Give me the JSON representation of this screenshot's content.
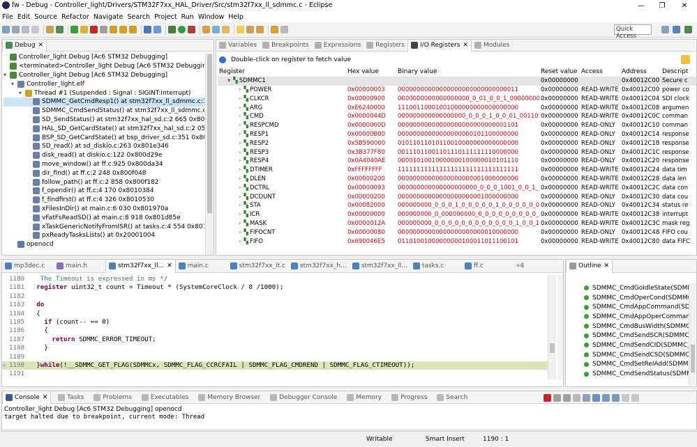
{
  "window": {
    "title": "fw - Debug - Controller_light/Drivers/STM32F7xx_HAL_Driver/Src/stm32f7xx_ll_sdmmc.c - Eclipse"
  },
  "menu": [
    "File",
    "Edit",
    "Source",
    "Refactor",
    "Navigate",
    "Search",
    "Project",
    "Run",
    "Window",
    "Help"
  ],
  "toolbar": {
    "quick_access": "Quick Access"
  },
  "debug": {
    "tab_label": "Debug",
    "rows": [
      {
        "depth": 0,
        "icon": "launch-icon",
        "label": "Controller_light Debug [Ac6 STM32 Debugging]"
      },
      {
        "depth": 0,
        "icon": "launch-icon",
        "label": "<terminated>Controller_light Debug [Ac6 STM32 Debugging]"
      },
      {
        "depth": 0,
        "icon": "launch-icon",
        "label": "Controller_light Debug [Ac6 STM32 Debugging]"
      },
      {
        "depth": 1,
        "icon": "elf-icon",
        "label": "Controller_light.elf"
      },
      {
        "depth": 2,
        "icon": "thread-icon",
        "label": "Thread #1 (Suspended : Signal : SIGINT:Interrupt)"
      },
      {
        "depth": 3,
        "icon": "stack-frame-icon",
        "label": "SDMMC_GetCmdResp1() at stm32f7xx_ll_sdmmc.c:1 190 0x800"
      },
      {
        "depth": 3,
        "icon": "stack-frame-icon",
        "label": "SDMMC_CmdSendStatus() at stm32f7xx_ll_sdmmc.c:1 057"
      },
      {
        "depth": 3,
        "icon": "stack-frame-icon",
        "label": "SD_SendStatus() at stm32f7xx_hal_sd.c:2 665 0x800698c"
      },
      {
        "depth": 3,
        "icon": "stack-frame-icon",
        "label": "HAL_SD_GetCardState() at stm32f7xx_hal_sd.c:2 052 0x800"
      },
      {
        "depth": 3,
        "icon": "stack-frame-icon",
        "label": "BSP_SD_GetCardState() at bsp_driver_sd.c:351 0x80144c8"
      },
      {
        "depth": 3,
        "icon": "stack-frame-icon",
        "label": "SD_read() at sd_diskio.c:263 0x801e346"
      },
      {
        "depth": 3,
        "icon": "stack-frame-icon",
        "label": "disk_read() at diskio.c:122 0x800d29e"
      },
      {
        "depth": 3,
        "icon": "stack-frame-icon",
        "label": "move_window() at ff.c:925 0x800da34"
      },
      {
        "depth": 3,
        "icon": "stack-frame-icon",
        "label": "dir_find() at ff.c:2 248 0x800f048"
      },
      {
        "depth": 3,
        "icon": "stack-frame-icon",
        "label": "follow_path() at ff.c:2 858 0x800f182"
      },
      {
        "depth": 3,
        "icon": "stack-frame-icon",
        "label": "f_opendir() at ff.c:4 170 0x8010384"
      },
      {
        "depth": 3,
        "icon": "stack-frame-icon",
        "label": "f_findfirst() at ff.c:4 326 0x8010530"
      },
      {
        "depth": 3,
        "icon": "stack-frame-icon",
        "label": "xFilesInDir() at main.c:6 030 0x801970a"
      },
      {
        "depth": 3,
        "icon": "stack-frame-icon",
        "label": "vFatFsReadSD() at main.c:8 918 0x801d85e"
      },
      {
        "depth": 3,
        "icon": "stack-frame-icon",
        "label": "xTaskGenericNotifyFromISR() at tasks.c:4 554 0x801241c"
      },
      {
        "depth": 3,
        "icon": "stack-frame-icon",
        "label": "pxReadyTasksLists() at 0x20001004"
      },
      {
        "depth": 1,
        "icon": "process-icon",
        "label": "openocd"
      }
    ]
  },
  "io_tabs": [
    "Variables",
    "Breakpoints",
    "Expressions",
    "Registers",
    "I/O Registers",
    "Modules"
  ],
  "io": {
    "hint": "Double-click on register to fetch value",
    "headers": [
      "Register",
      "Hex value",
      "Binary value",
      "Reset value",
      "Access",
      "Address",
      "Descript"
    ],
    "group": {
      "name": "SDMMC1",
      "reset": "0x00000000",
      "address": "0x40012C00",
      "desc": "Secure c"
    },
    "rows": [
      {
        "name": "POWER",
        "hex": "0x00000003",
        "bin": "00000000000000000000000000000011",
        "reset": "0x00000000",
        "access": "READ-WRITE",
        "addr": "0x40012C00",
        "desc": "power co"
      },
      {
        "name": "CLKCR",
        "hex": "0x00000900",
        "bin": "0000000000000000000_0_01_0_0_1_00000000",
        "reset": "0x00000000",
        "access": "READ-WRITE",
        "addr": "0x40012C04",
        "desc": "SDI clock"
      },
      {
        "name": "ARG",
        "hex": "0xE6240000",
        "bin": "11100110001001000000000000000000",
        "reset": "0x00000000",
        "access": "READ-WRITE",
        "addr": "0x40012C08",
        "desc": "argumen"
      },
      {
        "name": "CMD",
        "hex": "0x0000044D",
        "bin": "000000000000000000_0_0_0_1_0_0_01_001101",
        "reset": "0x00000000",
        "access": "READ-WRITE",
        "addr": "0x40012C0C",
        "desc": "comman"
      },
      {
        "name": "RESPCMD",
        "hex": "0x0000000D",
        "bin": "00000000000000000000000000001101",
        "reset": "0x00000000",
        "access": "READ-ONLY",
        "addr": "0x40012C10",
        "desc": "comman"
      },
      {
        "name": "RESP1",
        "hex": "0x00000B00",
        "bin": "00000000000000000000101100000000",
        "reset": "0x00000000",
        "access": "READ-ONLY",
        "addr": "0x40012C14",
        "desc": "response"
      },
      {
        "name": "RESP2",
        "hex": "0x5B590000",
        "bin": "01011011010110010000000000000000",
        "reset": "0x00000000",
        "access": "READ-ONLY",
        "addr": "0x40012C18",
        "desc": "response"
      },
      {
        "name": "RESP3",
        "hex": "0x3B377F80",
        "bin": "00111011001101110111111110000000",
        "reset": "0x00000000",
        "access": "READ-ONLY",
        "addr": "0x40012C1C",
        "desc": "response"
      },
      {
        "name": "RESP4",
        "hex": "0x0A4040AE",
        "bin": "00001010010000000100000010101110",
        "reset": "0x00000000",
        "access": "READ-ONLY",
        "addr": "0x40012C20",
        "desc": "response"
      },
      {
        "name": "DTIMER",
        "hex": "0xFFFFFFFF",
        "bin": "11111111111111111111111111111111",
        "reset": "0x00000000",
        "access": "READ-WRITE",
        "addr": "0x40012C24",
        "desc": "data tim"
      },
      {
        "name": "DLEN",
        "hex": "0x00000200",
        "bin": "00000000000000000000001000000000",
        "reset": "0x00000000",
        "access": "READ-WRITE",
        "addr": "0x40012C28",
        "desc": "data len"
      },
      {
        "name": "DCTRL",
        "hex": "0x00000093",
        "bin": "000000000000000000000_0_0_0_1001_0_0_1_1",
        "reset": "0x00000000",
        "access": "READ-WRITE",
        "addr": "0x40012C2C",
        "desc": "data con"
      },
      {
        "name": "DCOUNT",
        "hex": "0x00000200",
        "bin": "00000000000000000000001000000000",
        "reset": "0x00000000",
        "access": "READ-ONLY",
        "addr": "0x40012C30",
        "desc": "data cou"
      },
      {
        "name": "STA",
        "hex": "0x00082000",
        "bin": "000000000_0_0_0_1_0_0_0_0_0_1_0_0_0_0_0_0_0_0_0",
        "reset": "0x00000000",
        "access": "READ-ONLY",
        "addr": "0x40012C34",
        "desc": "status re"
      },
      {
        "name": "ICR",
        "hex": "0x00000000",
        "bin": "000000000_0_000000000_0_0_0_0_0_0_0_0_0_0_0",
        "reset": "0x00000000",
        "access": "READ-WRITE",
        "addr": "0x40012C38",
        "desc": "interrupt"
      },
      {
        "name": "MASK",
        "hex": "0x0000012A",
        "bin": "000000000_0_0_0_0_0_0_0_0_0_0_0_0_1_0_0_1_0_1",
        "reset": "0x00000000",
        "access": "READ-WRITE",
        "addr": "0x40012C3C",
        "desc": "mask reg"
      },
      {
        "name": "FIFOCNT",
        "hex": "0x00000080",
        "bin": "00000000000000000000000010000000",
        "reset": "0x00000000",
        "access": "READ-ONLY",
        "addr": "0x40012C48",
        "desc": "FIFO cou"
      },
      {
        "name": "FIFO",
        "hex": "0x690046E5",
        "bin": "01101001000000000100011011100101",
        "reset": "0x00000000",
        "access": "READ-WRITE",
        "addr": "0x40012C80",
        "desc": "data FIFC"
      }
    ]
  },
  "editor_tabs": [
    "mp3dec.c",
    "main.h",
    "stm32f7xx_ll...",
    "main.c",
    "stm32f7xx_it.c",
    "stm32f7xx_h...",
    "stm32f7xx_ll...",
    "tasks.c",
    "ff.c",
    "»4"
  ],
  "editor": {
    "lines": [
      {
        "n": "1180",
        "code": "   The Timeout is expressed in ms */",
        "style": "cm"
      },
      {
        "n": "1181",
        "code": "  register uint32_t count = Timeout * (SystemCoreClock / 8 /1000);",
        "style": "reg"
      },
      {
        "n": "1182",
        "code": "",
        "style": ""
      },
      {
        "n": "1183",
        "code": "  do",
        "style": "kw"
      },
      {
        "n": "1184",
        "code": "  {",
        "style": ""
      },
      {
        "n": "1185",
        "code": "    if (count-- == 0)",
        "style": "if"
      },
      {
        "n": "1186",
        "code": "    {",
        "style": ""
      },
      {
        "n": "1187",
        "code": "      return SDMMC_ERROR_TIMEOUT;",
        "style": "ret"
      },
      {
        "n": "1188",
        "code": "    }",
        "style": ""
      },
      {
        "n": "1189",
        "code": "",
        "style": ""
      },
      {
        "n": "1190",
        "code": "  }while(!__SDMMC_GET_FLAG(SDMMCx, SDMMC_FLAG_CCRCFAIL | SDMMC_FLAG_CMDREND | SDMMC_FLAG_CTIMEOUT));",
        "style": "cur"
      },
      {
        "n": "1191",
        "code": "",
        "style": ""
      }
    ]
  },
  "outline": {
    "tab_label": "Outline",
    "items": [
      "SDMMC_CmdGoIdleState(SDMMC",
      "SDMMC_CmdOperCond(SDMMC_",
      "SDMMC_CmdAppCommand(SDM",
      "SDMMC_CmdAppOperCommand(",
      "SDMMC_CmdBusWidth(SDMMC_T",
      "SDMMC_CmdSendSCR(SDMMC_T",
      "SDMMC_CmdSendCID(SDMMC_T",
      "SDMMC_CmdSendCSD(SDMMC_T",
      "SDMMC_CmdSetRelAdd(SDMMC",
      "SDMMC_CmdSendStatus(SDMM"
    ]
  },
  "console_tabs": [
    "Console",
    "Tasks",
    "Problems",
    "Executables",
    "Memory Browser",
    "Debugger Console",
    "Memory",
    "Progress",
    "Search"
  ],
  "console": {
    "process": "Controller_light Debug [Ac6 STM32 Debugging] openocd",
    "output": "target halted due to breakpoint, current mode: Thread"
  },
  "status": {
    "writable": "Writable",
    "insert_mode": "Smart Insert",
    "position": "1190 : 1"
  },
  "colors": {
    "accent": "#cde3f6",
    "red_value": "#e0000e",
    "keyword": "#7f0055",
    "comment": "#3f7f5f",
    "current_line": "#d8e6b8"
  }
}
